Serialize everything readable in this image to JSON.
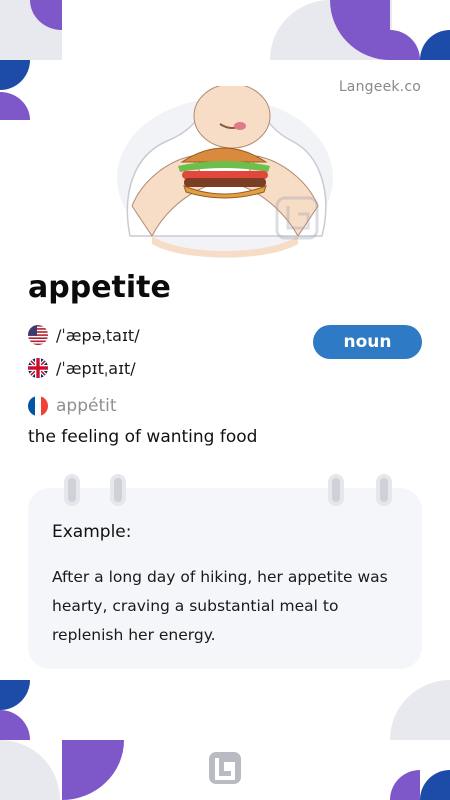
{
  "brand": {
    "site": "Langeek.co"
  },
  "entry": {
    "word": "appetite",
    "part_of_speech": "noun",
    "pronunciations": [
      {
        "region": "US",
        "flag_icon": "us-flag-icon",
        "ipa": "/ˈæpəˌtaɪt/"
      },
      {
        "region": "UK",
        "flag_icon": "uk-flag-icon",
        "ipa": "/ˈæpɪtˌaɪt/"
      }
    ],
    "translation": {
      "language": "French",
      "flag_icon": "france-flag-icon",
      "text": "appétit"
    },
    "definition": "the feeling of wanting food"
  },
  "example": {
    "title": "Example:",
    "sentence": "After a long day of hiking, her appetite was hearty, craving a substantial meal to replenish her energy."
  },
  "colors": {
    "accent_blue": "#2f7ac4",
    "deco_purple": "#7e57c8",
    "deco_navy": "#1c4ba8",
    "deco_gray": "#e8e9ef",
    "card_bg": "#f5f6fa"
  }
}
